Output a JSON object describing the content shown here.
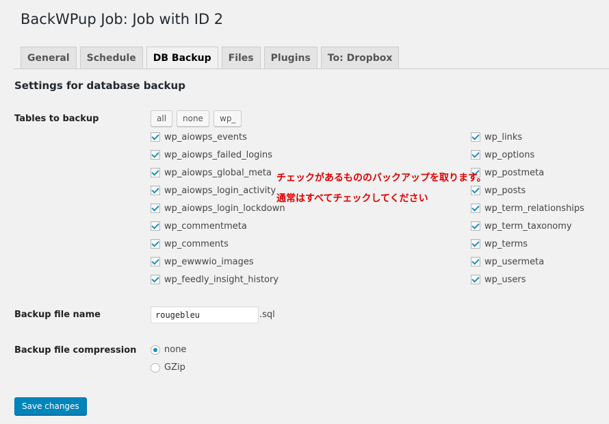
{
  "page": {
    "title": "BackWPup Job: Job with ID 2"
  },
  "tabs": [
    {
      "label": "General"
    },
    {
      "label": "Schedule"
    },
    {
      "label": "DB Backup",
      "active": true
    },
    {
      "label": "Files"
    },
    {
      "label": "Plugins"
    },
    {
      "label": "To: Dropbox"
    }
  ],
  "section": {
    "title": "Settings for database backup"
  },
  "tables": {
    "label": "Tables to backup",
    "buttons": {
      "all": "all",
      "none": "none",
      "prefix": "wp_"
    },
    "left": [
      {
        "name": "wp_aiowps_events",
        "checked": true
      },
      {
        "name": "wp_aiowps_failed_logins",
        "checked": true
      },
      {
        "name": "wp_aiowps_global_meta",
        "checked": true
      },
      {
        "name": "wp_aiowps_login_activity",
        "checked": true
      },
      {
        "name": "wp_aiowps_login_lockdown",
        "checked": true
      },
      {
        "name": "wp_commentmeta",
        "checked": true
      },
      {
        "name": "wp_comments",
        "checked": true
      },
      {
        "name": "wp_ewwwio_images",
        "checked": true
      },
      {
        "name": "wp_feedly_insight_history",
        "checked": true
      }
    ],
    "right": [
      {
        "name": "wp_links",
        "checked": true
      },
      {
        "name": "wp_options",
        "checked": true
      },
      {
        "name": "wp_postmeta",
        "checked": true
      },
      {
        "name": "wp_posts",
        "checked": true
      },
      {
        "name": "wp_term_relationships",
        "checked": true
      },
      {
        "name": "wp_term_taxonomy",
        "checked": true
      },
      {
        "name": "wp_terms",
        "checked": true
      },
      {
        "name": "wp_usermeta",
        "checked": true
      },
      {
        "name": "wp_users",
        "checked": true
      }
    ]
  },
  "annotation": {
    "line1": "チェックがあるもののバックアップを取ります。",
    "line2": "通常はすべてチェックしてください",
    "color": "#e00000"
  },
  "filename": {
    "label": "Backup file name",
    "value": "rougebleu",
    "extension": ".sql"
  },
  "compression": {
    "label": "Backup file compression",
    "options": [
      {
        "label": "none",
        "selected": true
      },
      {
        "label": "GZip",
        "selected": false
      }
    ]
  },
  "save": {
    "label": "Save changes"
  },
  "colors": {
    "accent": "#0085ba",
    "checkmark": "#1e8cbe"
  }
}
